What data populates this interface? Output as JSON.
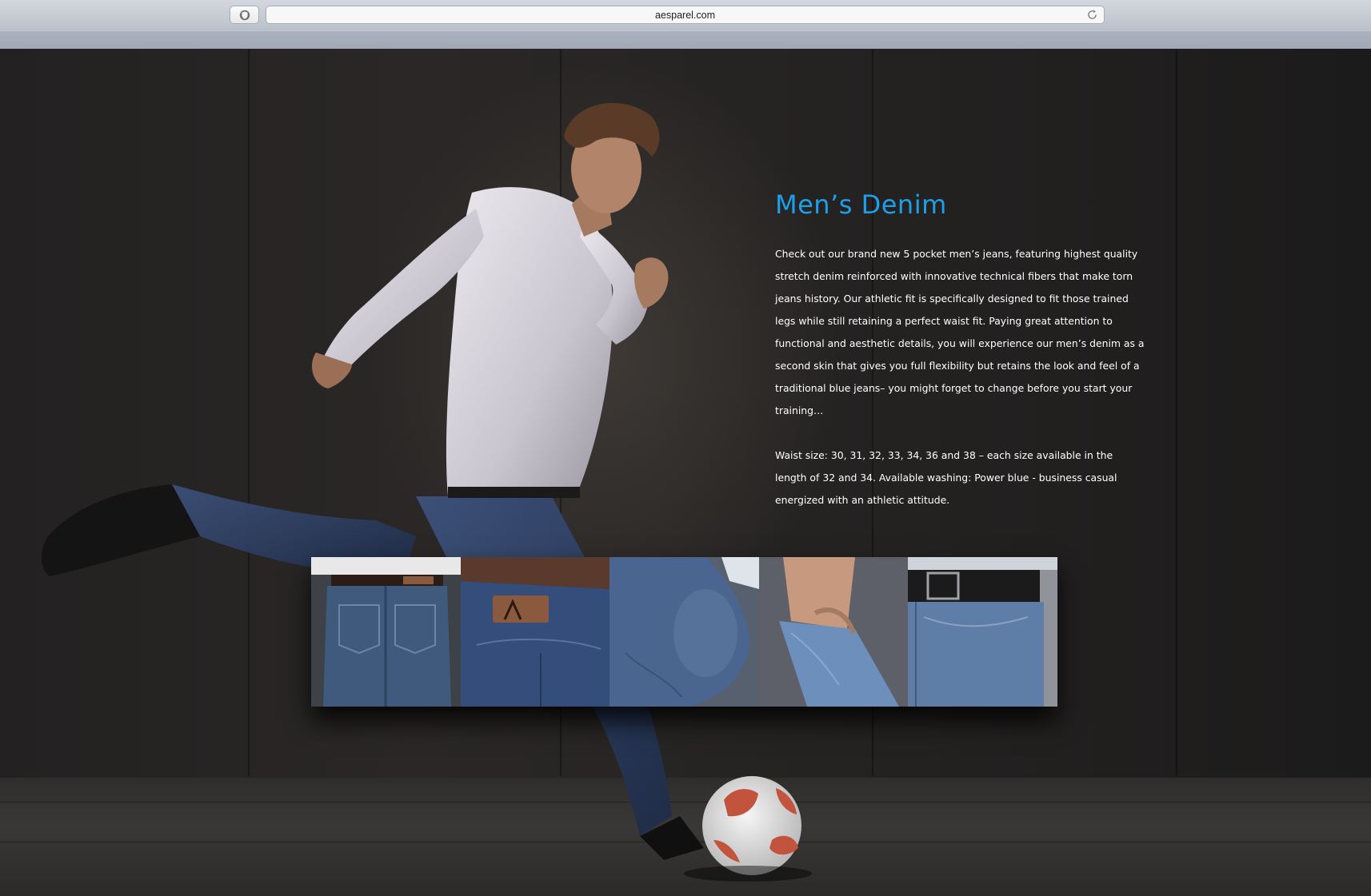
{
  "browser": {
    "url": "aesparel.com",
    "shield_icon": "shield-icon",
    "reload_icon": "reload-icon"
  },
  "product": {
    "title": "Men’s Denim",
    "description": "Check out our brand new 5 pocket men’s jeans, featuring highest quality stretch denim reinforced with innovative technical fibers that make torn jeans history. Our athletic fit is specifically designed to fit those trained legs while still retaining a perfect waist fit. Paying great attention to functional and aesthetic details, you will experience our men’s denim as a second skin that gives you full flexibility but retains the look and feel of a traditional blue jeans– you might forget to change before you start your training…",
    "sizes": "Waist size: 30, 31, 32, 33, 34, 36 and 38 – each size available in the length of 32 and 34. Available washing: Power blue - business casual energized with an athletic attitude."
  },
  "colors": {
    "title_accent": "#1da0e8",
    "body_text": "#ffffff",
    "background": "#1d1c1c"
  },
  "gallery": {
    "thumbnails": [
      "jeans-back-pockets",
      "jeans-leather-patch",
      "jeans-knee-raise",
      "jeans-front-pocket",
      "jeans-belt-front"
    ]
  }
}
